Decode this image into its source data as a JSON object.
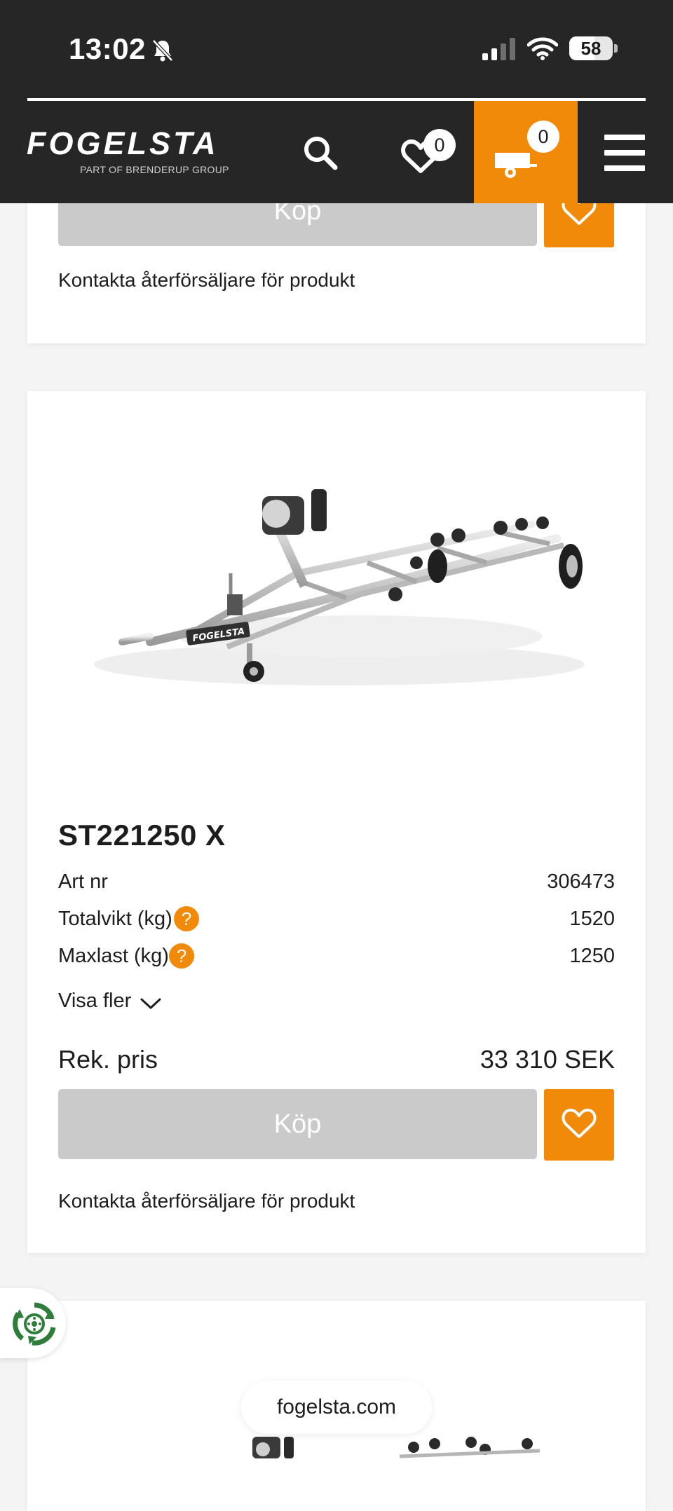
{
  "status_bar": {
    "time": "13:02",
    "battery": "58",
    "battery_level": 0.58,
    "icons": [
      "bell-slash-icon",
      "signal-icon",
      "wifi-icon",
      "battery-icon"
    ]
  },
  "header": {
    "logo_text": "FOGELSTA",
    "logo_subtitle": "PART OF BRENDERUP GROUP",
    "favorites_count": "0",
    "cart_count": "0",
    "icons": [
      "search-icon",
      "heart-icon",
      "trailer-cart-icon",
      "hamburger-menu-icon"
    ],
    "accent_color": "#f08a08",
    "background_color": "#262626"
  },
  "product_above": {
    "buy_label": "Köp",
    "contact_text": "Kontakta återförsäljare för produkt"
  },
  "product": {
    "title": "ST221250 X",
    "specs": [
      {
        "label": "Art nr",
        "value": "306473"
      },
      {
        "label": "Totalvikt (kg)",
        "value": "1520",
        "help": "?"
      },
      {
        "label": "Maxlast (kg)",
        "value": "1250",
        "help": "?"
      }
    ],
    "show_more": "Visa fler",
    "image_logo": "FOGELSTA",
    "price_label": "Rek. pris",
    "price_value": "33 310 SEK",
    "buy_label": "Köp",
    "contact_text": "Kontakta återförsäljare för produkt"
  },
  "browser": {
    "url": "fogelsta.com"
  },
  "floating": {
    "icon": "recycle-wheel-icon"
  }
}
